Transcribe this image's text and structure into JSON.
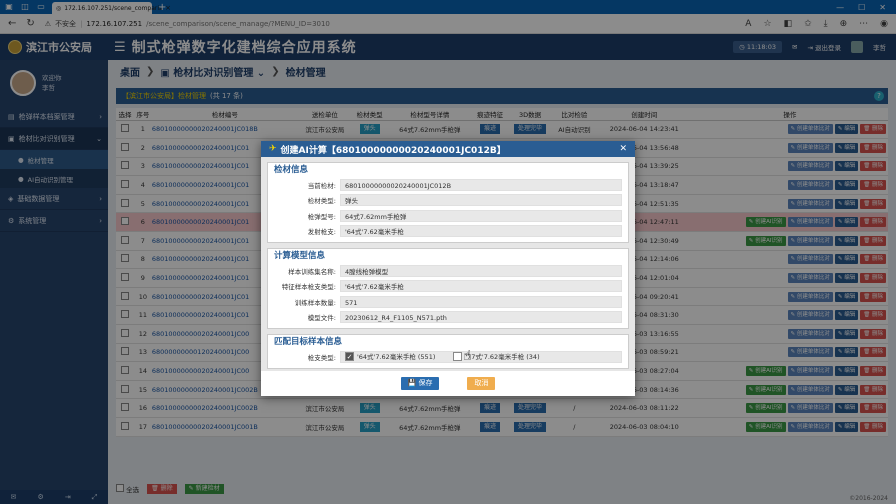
{
  "browser": {
    "tab_title": "172.16.107.251/scene_comparis",
    "insecure_label": "不安全",
    "url_host": "172.16.107.251",
    "url_path": "/scene_comparison/scene_manage/?MENU_ID=3010"
  },
  "header": {
    "org": "滨江市公安局",
    "system_title": "制式枪弹数字化建档综合应用系统",
    "clock": "11:18:03",
    "logout": "退出登录",
    "user": "李哲"
  },
  "sidebar": {
    "welcome": "欢迎你",
    "username": "李哲",
    "items": [
      {
        "label": "枪弹样本档案管理",
        "open": false
      },
      {
        "label": "枪材比对识别管理",
        "open": true
      },
      {
        "label": "基础数据管理",
        "open": false
      },
      {
        "label": "系统管理",
        "open": false
      }
    ],
    "subitems": [
      {
        "label": "枪材管理",
        "active": true
      },
      {
        "label": "AI自动识别管理",
        "active": false
      }
    ]
  },
  "breadcrumb": {
    "home": "桌面",
    "level1": "枪材比对识别管理",
    "level2": "检材管理"
  },
  "panel": {
    "org_bracket": "【滨江市公安局】",
    "title": "检材管理",
    "count_text": "(共 17 条)"
  },
  "table": {
    "headers": [
      "选择",
      "序号",
      "检材编号",
      "送检单位",
      "检材类型",
      "检材型号详情",
      "痕迹特征",
      "3D数据",
      "比对检验",
      "创建时间",
      "操作"
    ],
    "rows": [
      {
        "no": "1",
        "code": "68010000000020240001JC018B",
        "unit": "滨江市公安局",
        "type": "弹头",
        "detail": "64式7.62mm手枪弹",
        "trace": "痕迹",
        "d3": "处理完毕",
        "cmp": "AI自动识别",
        "time": "2024-06-04 14:23:41",
        "ai": false,
        "hl": false
      },
      {
        "no": "2",
        "code": "68010000000020240001JC01",
        "unit": "",
        "type": "",
        "detail": "",
        "trace": "",
        "d3": "",
        "cmp": "",
        "time": "2024-06-04 13:56:48",
        "ai": false,
        "hl": false
      },
      {
        "no": "3",
        "code": "68010000000020240001JC01",
        "unit": "",
        "type": "",
        "detail": "",
        "trace": "",
        "d3": "",
        "cmp": "",
        "time": "2024-06-04 13:39:25",
        "ai": false,
        "hl": false
      },
      {
        "no": "4",
        "code": "68010000000020240001JC01",
        "unit": "",
        "type": "",
        "detail": "",
        "trace": "",
        "d3": "",
        "cmp": "",
        "time": "2024-06-04 13:18:47",
        "ai": false,
        "hl": false
      },
      {
        "no": "5",
        "code": "68010000000020240001JC01",
        "unit": "",
        "type": "",
        "detail": "",
        "trace": "",
        "d3": "",
        "cmp": "",
        "time": "2024-06-04 12:51:35",
        "ai": false,
        "hl": false
      },
      {
        "no": "6",
        "code": "68010000000020240001JC01",
        "unit": "",
        "type": "",
        "detail": "",
        "trace": "",
        "d3": "",
        "cmp": "",
        "time": "2024-06-04 12:47:11",
        "ai": true,
        "hl": true
      },
      {
        "no": "7",
        "code": "68010000000020240001JC01",
        "unit": "",
        "type": "",
        "detail": "",
        "trace": "",
        "d3": "",
        "cmp": "",
        "time": "2024-06-04 12:30:49",
        "ai": true,
        "hl": false
      },
      {
        "no": "8",
        "code": "68010000000020240001JC01",
        "unit": "",
        "type": "",
        "detail": "",
        "trace": "",
        "d3": "",
        "cmp": "",
        "time": "2024-06-04 12:14:06",
        "ai": false,
        "hl": false
      },
      {
        "no": "9",
        "code": "68010000000020240001JC01",
        "unit": "",
        "type": "",
        "detail": "",
        "trace": "",
        "d3": "",
        "cmp": "",
        "time": "2024-06-04 12:01:04",
        "ai": false,
        "hl": false
      },
      {
        "no": "10",
        "code": "68010000000020240001JC01",
        "unit": "",
        "type": "",
        "detail": "",
        "trace": "",
        "d3": "",
        "cmp": "",
        "time": "2024-06-04 09:20:41",
        "ai": false,
        "hl": false
      },
      {
        "no": "11",
        "code": "68010000000020240001JC01",
        "unit": "",
        "type": "",
        "detail": "",
        "trace": "",
        "d3": "",
        "cmp": "",
        "time": "2024-06-04 08:31:30",
        "ai": false,
        "hl": false
      },
      {
        "no": "12",
        "code": "68010000000020240001JC00",
        "unit": "",
        "type": "",
        "detail": "",
        "trace": "",
        "d3": "",
        "cmp": "",
        "time": "2024-06-03 13:16:55",
        "ai": false,
        "hl": false
      },
      {
        "no": "13",
        "code": "68000000000120240001JC00",
        "unit": "",
        "type": "",
        "detail": "",
        "trace": "",
        "d3": "",
        "cmp": "",
        "time": "2024-06-03 08:59:21",
        "ai": false,
        "hl": false
      },
      {
        "no": "14",
        "code": "68010000000020240001JC00",
        "unit": "",
        "type": "",
        "detail": "",
        "trace": "",
        "d3": "",
        "cmp": "",
        "time": "2024-06-03 08:27:04",
        "ai": true,
        "hl": false
      },
      {
        "no": "15",
        "code": "68010000000020240001JC002B",
        "unit": "滨江市公安局",
        "type": "弹头",
        "detail": "64式7.62mm手枪弹",
        "trace": "痕迹",
        "d3": "处理完毕",
        "cmp": "/",
        "time": "2024-06-03 08:14:36",
        "ai": true,
        "hl": false
      },
      {
        "no": "16",
        "code": "68010000000020240001JC002B",
        "unit": "滨江市公安局",
        "type": "弹头",
        "detail": "64式7.62mm手枪弹",
        "trace": "痕迹",
        "d3": "处理完毕",
        "cmp": "/",
        "time": "2024-06-03 08:11:22",
        "ai": true,
        "hl": false
      },
      {
        "no": "17",
        "code": "68010000000020240001JC001B",
        "unit": "滨江市公安局",
        "type": "弹头",
        "detail": "64式7.62mm手枪弹",
        "trace": "痕迹",
        "d3": "处理完毕",
        "cmp": "/",
        "time": "2024-06-03 08:04:10",
        "ai": true,
        "hl": false
      }
    ],
    "ops": {
      "ai": "创建AI识别",
      "single": "创建单体比对",
      "edit": "编辑",
      "del": "删除"
    }
  },
  "footer": {
    "select_all": "全选",
    "delete": "删除",
    "new_specimen": "新建检材",
    "copyright": "©2016-2024"
  },
  "modal": {
    "title": "创建AI计算【68010000000020240001JC012B】",
    "sections": [
      {
        "legend": "检材信息",
        "fields": [
          {
            "label": "当前检材:",
            "value": "68010000000020240001JC012B"
          },
          {
            "label": "检材类型:",
            "value": "弹头"
          },
          {
            "label": "枪弹型号:",
            "value": "64式7.62mm手枪弹"
          },
          {
            "label": "发射枪支:",
            "value": "'64式'7.62毫米手枪"
          }
        ]
      },
      {
        "legend": "计算模型信息",
        "fields": [
          {
            "label": "样本训练集名称:",
            "value": "4膛线枪弹模型"
          },
          {
            "label": "特征样本枪支类型:",
            "value": "'64式'7.62毫米手枪"
          },
          {
            "label": "训练样本数量:",
            "value": "571"
          },
          {
            "label": "模型文件:",
            "value": "20230612_R4_F1105_N571.pth"
          }
        ]
      }
    ],
    "match": {
      "legend": "匹配目标样本信息",
      "label": "枪支类型:",
      "options": [
        {
          "text": "'64式'7.62毫米手枪 (551)",
          "checked": true
        },
        {
          "text": "'77式'7.62毫米手枪 (34)",
          "checked": false
        }
      ]
    },
    "save": "保存",
    "cancel": "取消"
  }
}
